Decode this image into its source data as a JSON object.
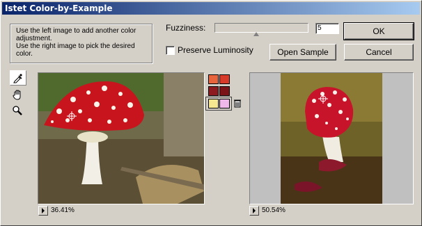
{
  "window": {
    "title": "Istet Color-by-Example"
  },
  "instructions": {
    "line1": "Use the left image to add another color",
    "line2": "adjustment.",
    "line3": "Use the right image to pick the desired color."
  },
  "fuzziness": {
    "label": "Fuzziness:",
    "value": "5",
    "slider_fraction": 0.42
  },
  "preserve_luminosity": {
    "label": "Preserve Luminosity",
    "checked": false
  },
  "buttons": {
    "ok": "OK",
    "cancel": "Cancel",
    "open_sample": "Open Sample"
  },
  "tools": [
    "eyedropper-icon",
    "hand-icon",
    "magnifier-icon"
  ],
  "swatches": {
    "rows": [
      [
        "#e8643c",
        "#d83a2a"
      ],
      [
        "#8c1a1e",
        "#7a1418"
      ],
      [
        "#f5e890",
        "#f0b8e8"
      ]
    ]
  },
  "left_image": {
    "zoom": "36.41%"
  },
  "right_image": {
    "zoom": "50.54%"
  }
}
